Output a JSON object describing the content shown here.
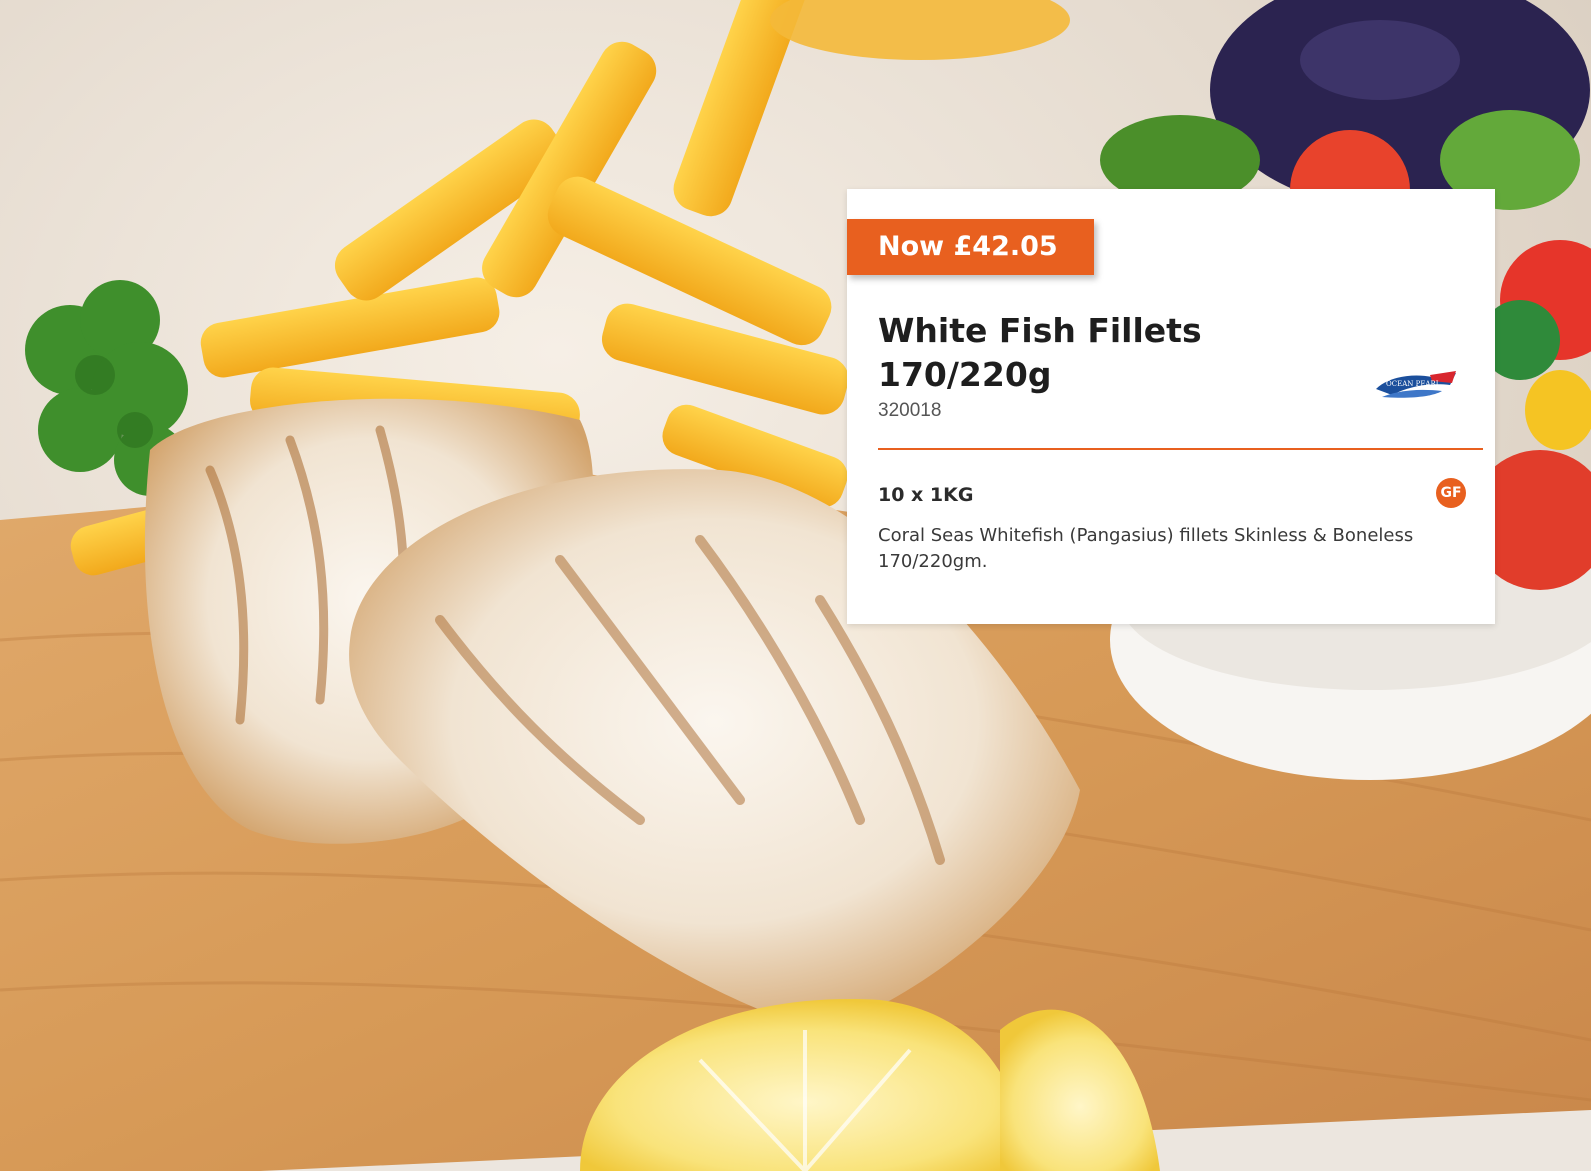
{
  "product": {
    "price_label": "Now £42.05",
    "title_line1": "White Fish Fillets",
    "title_line2": "170/220g",
    "code": "320018",
    "pack_size": "10 x 1KG",
    "dietary_badge": "GF",
    "description": "Coral Seas Whitefish (Pangasius) fillets Skinless & Boneless 170/220gm.",
    "brand_logo_text": "OCEAN PEARL"
  },
  "colors": {
    "accent": "#e8601f",
    "card_background": "#ffffff",
    "title_text": "#1e1e1e",
    "brand_blue": "#1b4f9c"
  },
  "icons": {
    "gf_badge": "gluten-free-badge-icon",
    "brand": "ocean-pearl-logo-icon"
  }
}
